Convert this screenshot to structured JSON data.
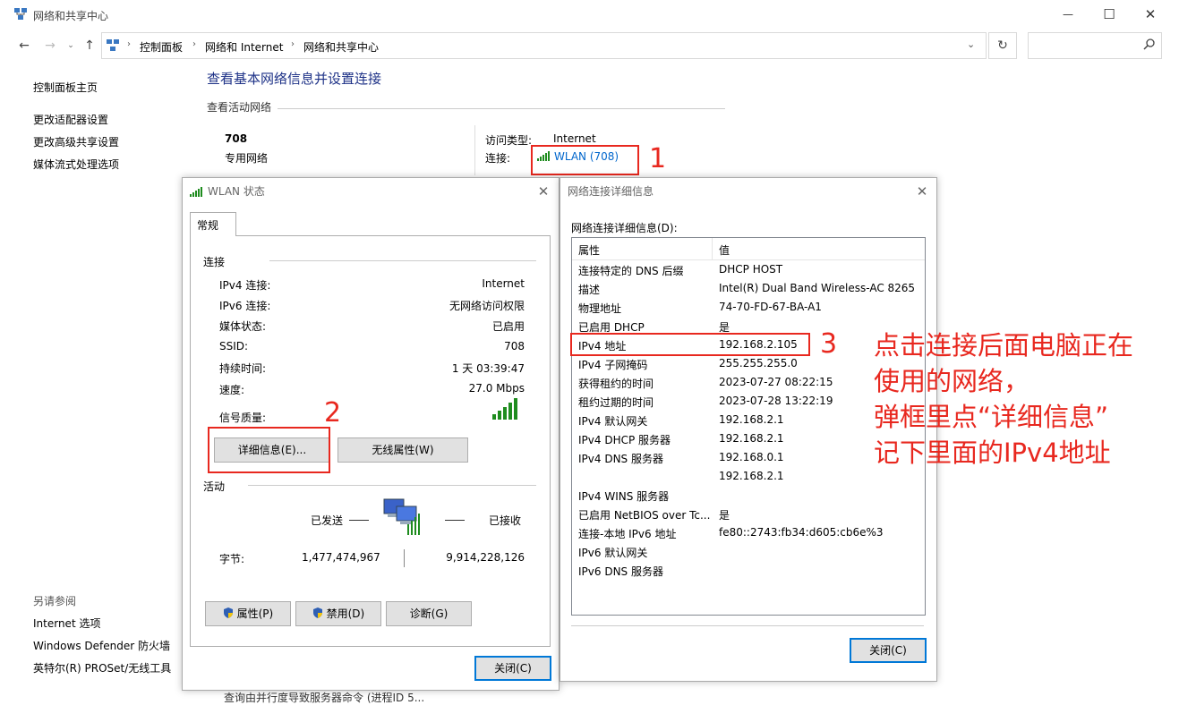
{
  "window": {
    "title": "网络和共享中心",
    "controls": {
      "minimize": "—",
      "maximize": "☐",
      "close": "✕"
    }
  },
  "address": {
    "breadcrumbs": [
      "控制面板",
      "网络和 Internet",
      "网络和共享中心"
    ],
    "separator": "›",
    "search_placeholder": ""
  },
  "sidebar": {
    "home": "控制面板主页",
    "links": [
      "更改适配器设置",
      "更改高级共享设置",
      "媒体流式处理选项"
    ],
    "see_also_title": "另请参阅",
    "see_also": [
      "Internet 选项",
      "Windows Defender 防火墙",
      "英特尔(R) PROSet/无线工具"
    ]
  },
  "main": {
    "heading": "查看基本网络信息并设置连接",
    "active_networks_label": "查看活动网络",
    "network_name": "708",
    "network_type": "专用网络",
    "access_type_label": "访问类型:",
    "access_type_value": "Internet",
    "connection_label": "连接:",
    "connection_value": "WLAN (708)",
    "bottom_truncated": "查询由并行度导致服务器命令 (进程ID 5..."
  },
  "wlan_status": {
    "title": "WLAN 状态",
    "tab": "常规",
    "connection_section": "连接",
    "rows": [
      {
        "label": "IPv4 连接:",
        "value": "Internet"
      },
      {
        "label": "IPv6 连接:",
        "value": "无网络访问权限"
      },
      {
        "label": "媒体状态:",
        "value": "已启用"
      },
      {
        "label": "SSID:",
        "value": "708"
      },
      {
        "label": "持续时间:",
        "value": "1 天 03:39:47"
      },
      {
        "label": "速度:",
        "value": "27.0 Mbps"
      }
    ],
    "signal_label": "信号质量:",
    "details_button": "详细信息(E)...",
    "wireless_props_button": "无线属性(W)",
    "activity_section": "活动",
    "sent_label": "已发送",
    "received_label": "已接收",
    "bytes_label": "字节:",
    "bytes_sent": "1,477,474,967",
    "bytes_received": "9,914,228,126",
    "properties_button": "属性(P)",
    "disable_button": "禁用(D)",
    "diagnose_button": "诊断(G)",
    "close_button": "关闭(C)"
  },
  "details": {
    "title": "网络连接详细信息",
    "list_label": "网络连接详细信息(D):",
    "col_property": "属性",
    "col_value": "值",
    "rows": [
      {
        "p": "连接特定的 DNS 后缀",
        "v": "DHCP HOST"
      },
      {
        "p": "描述",
        "v": "Intel(R) Dual Band Wireless-AC 8265"
      },
      {
        "p": "物理地址",
        "v": "74-70-FD-67-BA-A1"
      },
      {
        "p": "已启用 DHCP",
        "v": "是"
      },
      {
        "p": "IPv4 地址",
        "v": "192.168.2.105"
      },
      {
        "p": "IPv4 子网掩码",
        "v": "255.255.255.0"
      },
      {
        "p": "获得租约的时间",
        "v": "2023-07-27 08:22:15"
      },
      {
        "p": "租约过期的时间",
        "v": "2023-07-28 13:22:19"
      },
      {
        "p": "IPv4 默认网关",
        "v": "192.168.2.1"
      },
      {
        "p": "IPv4 DHCP 服务器",
        "v": "192.168.2.1"
      },
      {
        "p": "IPv4 DNS 服务器",
        "v": "192.168.0.1"
      },
      {
        "p": "",
        "v": "192.168.2.1"
      },
      {
        "p": "IPv4 WINS 服务器",
        "v": ""
      },
      {
        "p": "已启用 NetBIOS over Tc...",
        "v": "是"
      },
      {
        "p": "连接-本地 IPv6 地址",
        "v": "fe80::2743:fb34:d605:cb6e%3"
      },
      {
        "p": "IPv6 默认网关",
        "v": ""
      },
      {
        "p": "IPv6 DNS 服务器",
        "v": ""
      }
    ],
    "close_button": "关闭(C)"
  },
  "annotations": {
    "n1": "1",
    "n2": "2",
    "n3": "3",
    "note_lines": [
      "点击连接后面电脑正在",
      "使用的网络，",
      "弹框里点“详细信息”",
      "记下里面的IPv4地址"
    ],
    "color": "#e8281f"
  }
}
